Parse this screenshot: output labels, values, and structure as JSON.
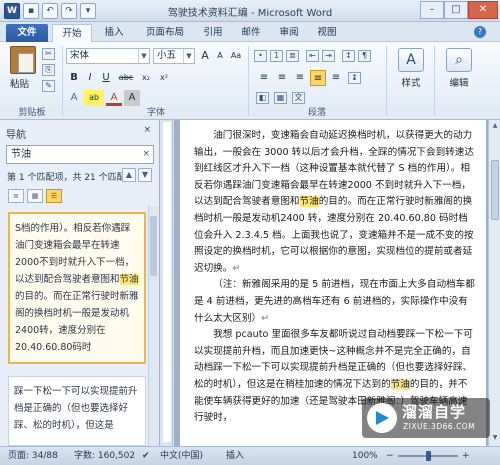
{
  "window": {
    "title": "驾驶技术资料汇编 - Microsoft Word",
    "min_label": "–",
    "max_label": "□",
    "close_label": "✕"
  },
  "qat": {
    "word": "W",
    "save": "▪",
    "undo": "↶",
    "redo": "↷",
    "more": "▾"
  },
  "tabs": {
    "file": "文件",
    "home": "开始",
    "insert": "插入",
    "layout": "页面布局",
    "references": "引用",
    "mailings": "邮件",
    "review": "审阅",
    "view": "视图",
    "help": "?"
  },
  "ribbon": {
    "clipboard": {
      "paste": "粘贴",
      "label": "剪贴板"
    },
    "font": {
      "name": "宋体",
      "size": "小五",
      "label": "字体",
      "bold": "B",
      "italic": "I",
      "underline": "U",
      "strike": "abc",
      "sub": "x₂",
      "sup": "x²",
      "grow": "A",
      "shrink": "A",
      "clear": "Aa",
      "phonetic": "A",
      "highlight": "ab",
      "color": "A",
      "charshade": "A"
    },
    "paragraph": {
      "label": "段落",
      "align_left": "≡",
      "align_center": "≡",
      "align_right": "≡",
      "justify": "≡",
      "distributed": "≡"
    },
    "styles": {
      "label": "样式"
    },
    "editing": {
      "label": "编辑"
    }
  },
  "nav": {
    "title": "导航",
    "close": "×",
    "search_value": "节油",
    "search_clear": "×",
    "count_text": "第 1 个匹配项，共 21 个匹配项",
    "prev": "▲",
    "next": "▼",
    "result1_pre": "S档的作用）。相反若你遇踩油门变速箱会最早在转速2000不到时就升入下一档，以达到配合驾驶者意图和",
    "result1_hl": "节油",
    "result1_post": "的目的。而在正常行驶时新雅阁的换档时机一般是发动机2400转，速度分别在20.40.60.80码时",
    "result2": "踩一下松一下可以实现提前升档是正确的（但也要选择好踩、松的时机），但这是"
  },
  "doc": {
    "lines": [
      "油门很深时，变速箱会自动延迟换档时机，以获得更大的动力输出，一般会在 3000 转以后才会升档，全踩的情况下会到转速达到红线区才升入下一档（这种设置基本就代替了 S 档的作用）。相反若你遇踩油门变速箱会最早在转速2000 不到时就升入下一档，以达到配合驾驶者意图和",
      "节油",
      "的目的。而在正常行驶时新雅阁的换档时机一般是发动机2400 转，速度分别在 20.40.60.80 码时档位会升入 2.3.4.5 档。上面我也说了，变速箱并不是一成不变的按照设定的换档时机，它可以根据你的意图，实现档位的提前或者延迟切换。",
      "（注：新雅阁采用的是 5 前进档，现在市面上大多自动档车都是 4 前进档，更先进的高档车还有 6 前进档的，实际操作中没有什么太大区别）",
      "我想 pcauto 里面很多车友都听说过自动档要踩一下松一下可以实现提前升档，而且加速更快~这种概念并不是完全正确的，自动档踩一下松一下可以实现提前升档是正确的（但也要选择好踩、松的时机），但这是在稍桂加速的情况下达到的",
      "节油",
      "的目的，并不能使车辆获得更好的加速（还是驾驶本田新雅阁：）驾驶车辆高速行驶时，"
    ],
    "para_mark": "↵"
  },
  "status": {
    "page": "页面: 34/88",
    "words": "字数: 160,502",
    "lang": "中文(中国)",
    "insert": "插入",
    "zoom": "100%",
    "zoom_minus": "−",
    "zoom_plus": "+"
  },
  "watermark": {
    "name": "溜溜自学",
    "url": "ZIXUE.3D66.COM"
  }
}
